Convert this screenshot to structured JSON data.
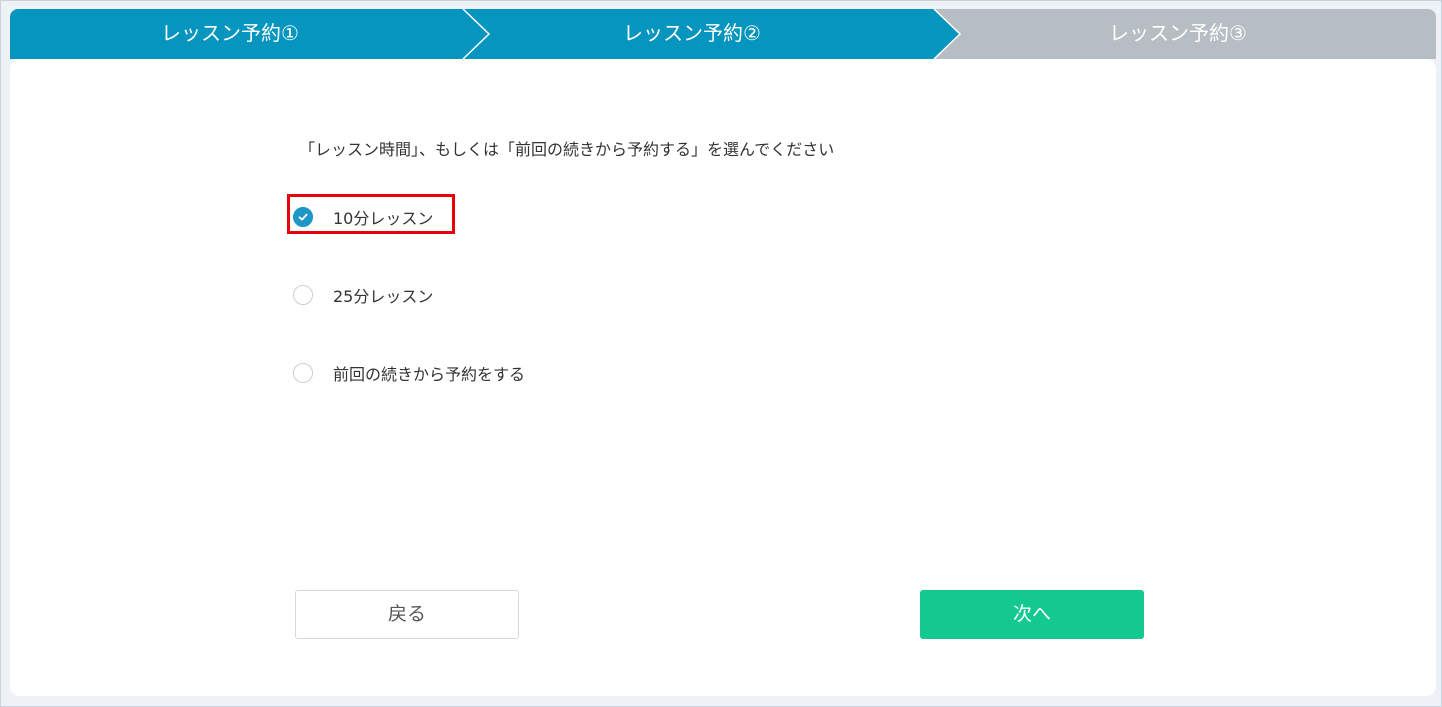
{
  "stepper": {
    "steps": [
      {
        "label": "レッスン予約①",
        "state": "done"
      },
      {
        "label": "レッスン予約②",
        "state": "current"
      },
      {
        "label": "レッスン予約③",
        "state": "upcoming"
      }
    ],
    "active_color": "#0595bf",
    "inactive_color": "#b6bec3"
  },
  "instruction": "「レッスン時間」、もしくは「前回の続きから予約する」を選んでください",
  "options": [
    {
      "label": "10分レッスン",
      "checked": true
    },
    {
      "label": "25分レッスン",
      "checked": false
    },
    {
      "label": "前回の続きから予約をする",
      "checked": false
    }
  ],
  "buttons": {
    "back_label": "戻る",
    "next_label": "次へ"
  },
  "colors": {
    "accent": "#1e97c8",
    "next_button": "#13c990",
    "highlight": "#e8000b"
  },
  "icons": {
    "checked_radio": "check-icon"
  }
}
